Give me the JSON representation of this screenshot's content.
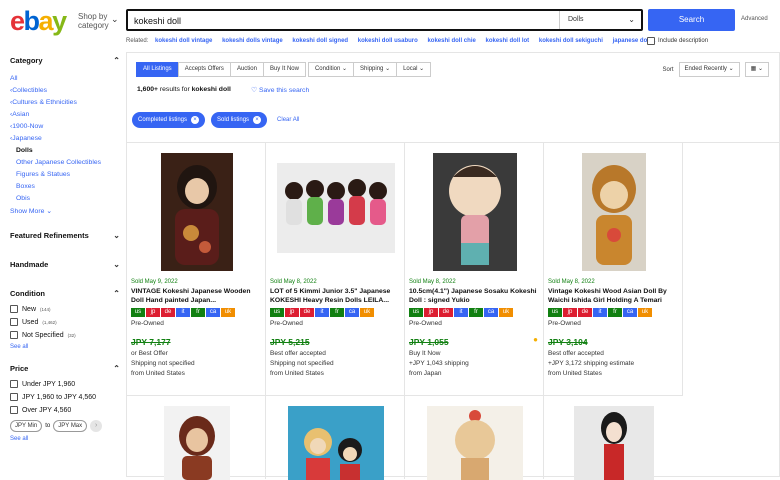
{
  "header": {
    "logo": {
      "e": "e",
      "b": "b",
      "a": "a",
      "y": "y"
    },
    "shop_by": "Shop by",
    "category": "category",
    "search_query": "kokeshi doll",
    "search_category": "Dolls",
    "search_button": "Search",
    "advanced": "Advanced"
  },
  "related": {
    "label": "Related:",
    "items": [
      "kokeshi doll vintage",
      "kokeshi dolls vintage",
      "kokeshi doll signed",
      "kokeshi doll usaburo",
      "kokeshi doll chie",
      "kokeshi doll lot",
      "kokeshi doll sekiguchi",
      "japanese doll..."
    ],
    "include_description": "Include description"
  },
  "sidebar": {
    "category_heading": "Category",
    "category_links": [
      "All",
      "Collectibles",
      "Cultures & Ethnicities",
      "Asian",
      "1900-Now",
      "Japanese"
    ],
    "current": "Dolls",
    "subcategories": [
      "Other Japanese Collectibles",
      "Figures & Statues",
      "Boxes",
      "Obis"
    ],
    "show_more": "Show More",
    "featured": "Featured Refinements",
    "handmade": "Handmade",
    "condition_heading": "Condition",
    "conditions": [
      {
        "label": "New",
        "count": "(144)"
      },
      {
        "label": "Used",
        "count": "(1,462)"
      },
      {
        "label": "Not Specified",
        "count": "(32)"
      }
    ],
    "see_all": "See all",
    "price_heading": "Price",
    "prices": [
      "Under JPY 1,960",
      "JPY 1,960 to JPY 4,560",
      "Over JPY 4,560"
    ],
    "price_min": "JPY Min",
    "price_max": "JPY Max",
    "to": "to",
    "see_all2": "See all"
  },
  "filters": {
    "tabs": [
      "All Listings",
      "Accepts Offers",
      "Auction",
      "Buy It Now"
    ],
    "dropdowns": [
      "Condition",
      "Shipping",
      "Local"
    ],
    "sort_label": "Sort",
    "sort_value": "Ended Recently"
  },
  "results": {
    "count": "1,600+",
    "text": "results for",
    "query": "kokeshi doll",
    "save": "Save this search"
  },
  "chips": [
    "Completed listings",
    "Sold listings"
  ],
  "clear_all": "Clear All",
  "colors": {
    "accent": "#3665f3",
    "sold_green": "#118011",
    "flag_green": "#118011",
    "flag_red": "#dd1e31",
    "flag_blue": "#3665f3",
    "flag_orange": "#f18e00"
  },
  "flags": [
    "us",
    "jp",
    "de",
    "it",
    "fr",
    "ca",
    "uk"
  ],
  "listings": [
    {
      "sold": "Sold May 9, 2022",
      "title": "VINTAGE Kokeshi Japanese Wooden Doll Hand painted Japan...",
      "condition": "Pre-Owned",
      "price": "JPY 7,177",
      "line1": "or Best Offer",
      "line2": "Shipping not specified",
      "line3": "from United States"
    },
    {
      "sold": "Sold May 8, 2022",
      "title": "LOT of 5 Kimmi Junior 3.5\" Japanese KOKESHI Heavy Resin Dolls LEILA...",
      "condition": "Pre-Owned",
      "price": "JPY 5,215",
      "line1": "Best offer accepted",
      "line2": "Shipping not specified",
      "line3": "from United States"
    },
    {
      "sold": "Sold May 8, 2022",
      "title": "10.5cm(4.1\") Japanese Sosaku Kokeshi Doll : signed Yukio",
      "condition": "Pre-Owned",
      "price": "JPY 1,055",
      "line1": "Buy It Now",
      "line2": "+JPY 1,043 shipping",
      "line3": "from Japan"
    },
    {
      "sold": "Sold May 8, 2022",
      "title": "Vintage Kokeshi Wood Asian Doll By Waichi Ishida Girl Holding A Temari",
      "condition": "Pre-Owned",
      "price": "JPY 3,104",
      "line1": "Best offer accepted",
      "line2": "+JPY 3,172 shipping estimate",
      "line3": "from United States"
    }
  ]
}
